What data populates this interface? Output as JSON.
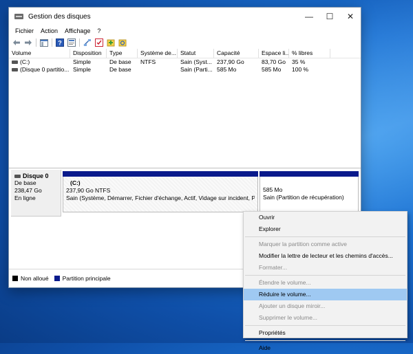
{
  "window": {
    "title": "Gestion des disques",
    "controls": [
      "—",
      "☐",
      "✕"
    ]
  },
  "menu": [
    "Fichier",
    "Action",
    "Affichage",
    "?"
  ],
  "table": {
    "columns": [
      "Volume",
      "Disposition",
      "Type",
      "Système de...",
      "Statut",
      "Capacité",
      "Espace li...",
      "% libres"
    ],
    "rows": [
      [
        "(C:)",
        "Simple",
        "De base",
        "NTFS",
        "Sain (Syst...",
        "237,90 Go",
        "83,70 Go",
        "35 %"
      ],
      [
        "(Disque 0 partitio...",
        "Simple",
        "De base",
        "",
        "Sain (Parti...",
        "585 Mo",
        "585 Mo",
        "100 %"
      ]
    ]
  },
  "disk": {
    "name": "Disque 0",
    "type": "De base",
    "size": "238,47 Go",
    "status": "En ligne",
    "partitions": [
      {
        "name": "(C:)",
        "size": "237,90 Go NTFS",
        "status": "Sain (Système, Démarrer, Fichier d'échange, Actif, Vidage sur incident, Partit"
      },
      {
        "name": "",
        "size": "585 Mo",
        "status": "Sain (Partition de récupération)"
      }
    ]
  },
  "legend": [
    {
      "label": "Non alloué",
      "color": "#000000"
    },
    {
      "label": "Partition principale",
      "color": "#0a1a8c"
    }
  ],
  "context_menu": [
    {
      "label": "Ouvrir",
      "enabled": true
    },
    {
      "label": "Explorer",
      "enabled": true
    },
    {
      "sep": true
    },
    {
      "label": "Marquer la partition comme active",
      "enabled": false
    },
    {
      "label": "Modifier la lettre de lecteur et les chemins d'accès...",
      "enabled": true
    },
    {
      "label": "Formater...",
      "enabled": false
    },
    {
      "sep": true
    },
    {
      "label": "Étendre le volume...",
      "enabled": false
    },
    {
      "label": "Réduire le volume...",
      "enabled": true,
      "highlighted": true
    },
    {
      "label": "Ajouter un disque miroir...",
      "enabled": false
    },
    {
      "label": "Supprimer le volume...",
      "enabled": false
    },
    {
      "sep": true
    },
    {
      "label": "Propriétés",
      "enabled": true
    },
    {
      "sep": true
    },
    {
      "label": "Aide",
      "enabled": true
    }
  ],
  "colors": {
    "primary_partition": "#0a1a8c",
    "highlight": "#9fc9f2"
  }
}
